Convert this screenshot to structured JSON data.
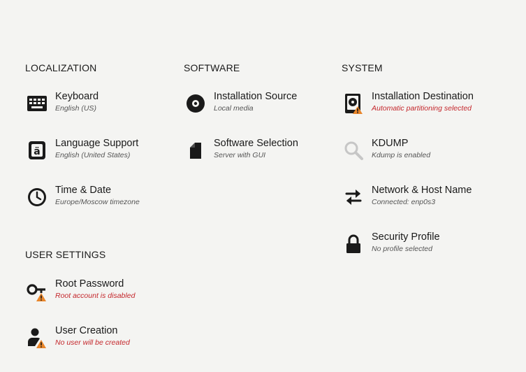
{
  "colors": {
    "background": "#f4f4f2",
    "text": "#1a1a1a",
    "status_text": "#555555",
    "warning_text": "#c4262b",
    "warning_icon": "#e8852a"
  },
  "localization": {
    "title": "LOCALIZATION",
    "keyboard": {
      "label": "Keyboard",
      "status": "English (US)",
      "icon": "keyboard-icon"
    },
    "language": {
      "label": "Language Support",
      "status": "English (United States)",
      "icon": "language-icon"
    },
    "time": {
      "label": "Time & Date",
      "status": "Europe/Moscow timezone",
      "icon": "clock-icon"
    }
  },
  "software": {
    "title": "SOFTWARE",
    "source": {
      "label": "Installation Source",
      "status": "Local media",
      "icon": "disc-icon"
    },
    "selection": {
      "label": "Software Selection",
      "status": "Server with GUI",
      "icon": "package-icon"
    }
  },
  "system": {
    "title": "SYSTEM",
    "destination": {
      "label": "Installation Destination",
      "status": "Automatic partitioning selected",
      "icon": "harddisk-warning-icon"
    },
    "kdump": {
      "label": "KDUMP",
      "status": "Kdump is enabled",
      "icon": "magnifier-icon"
    },
    "network": {
      "label": "Network & Host Name",
      "status": "Connected: enp0s3",
      "icon": "network-arrows-icon"
    },
    "security": {
      "label": "Security Profile",
      "status": "No profile selected",
      "icon": "lock-icon"
    }
  },
  "user_settings": {
    "title": "USER SETTINGS",
    "root": {
      "label": "Root Password",
      "status": "Root account is disabled",
      "icon": "key-warning-icon"
    },
    "user": {
      "label": "User Creation",
      "status": "No user will be created",
      "icon": "user-warning-icon"
    }
  }
}
